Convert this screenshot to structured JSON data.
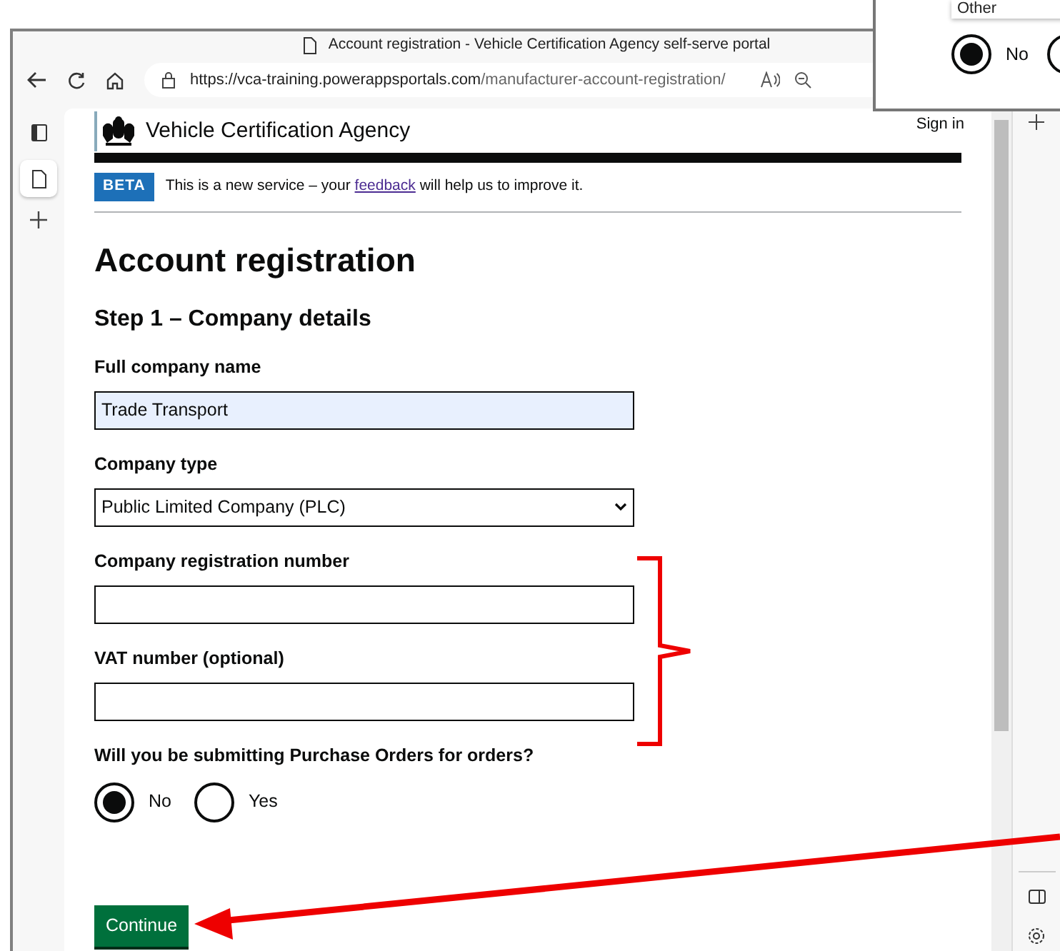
{
  "browser": {
    "tab_title": "Account registration - Vehicle Certification Agency self-serve portal",
    "url_host": "https://vca-training.powerappsportals.com",
    "url_path": "/manufacturer-account-registration/"
  },
  "header": {
    "service_name": "Vehicle Certification Agency",
    "sign_in": "Sign in"
  },
  "phase_banner": {
    "tag": "BETA",
    "text_before": "This is a new service – your ",
    "link": "feedback",
    "text_after": " will help us to improve it."
  },
  "heading": "Account registration",
  "step": "Step 1 – Company details",
  "fields": [
    {
      "kind": "text",
      "label": "Full company name",
      "value": "Trade Transport",
      "autofilled": true
    },
    {
      "kind": "select",
      "label": "Company type",
      "value": "Public Limited Company (PLC)",
      "autofilled": false
    },
    {
      "kind": "text",
      "label": "Company registration number",
      "autofilled": false
    },
    {
      "kind": "text",
      "label": "VAT number (optional)",
      "autofilled": false
    }
  ],
  "question": {
    "label": "Will you be submitting Purchase Orders for orders?",
    "options": [
      {
        "label": "No",
        "selected": true
      },
      {
        "label": "Yes",
        "selected": false
      }
    ]
  },
  "continue_button": "Continue",
  "inset": {
    "dropdown_option": "Other",
    "options": [
      {
        "label": "No",
        "selected": true
      },
      {
        "selected": false
      }
    ]
  }
}
